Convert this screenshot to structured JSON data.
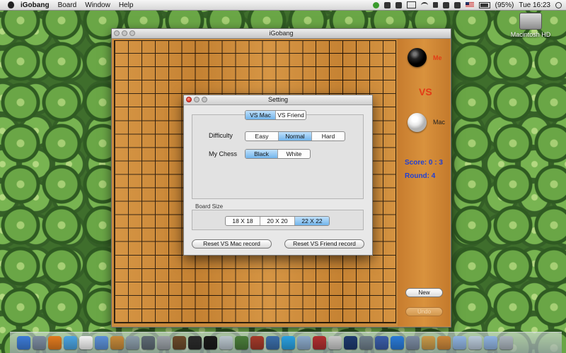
{
  "menubar": {
    "app_name": "iGobang",
    "items": [
      "Board",
      "Window",
      "Help"
    ],
    "battery": "(95%)",
    "clock": "Tue 16:23",
    "icons": [
      "apple-icon",
      "green-status-icon",
      "evernote-icon",
      "sync-icon",
      "display-icon",
      "wifi-icon",
      "lock-icon",
      "bluetooth-icon",
      "volume-icon",
      "flag-icon",
      "battery-icon",
      "search-icon"
    ]
  },
  "desktop": {
    "hd_label": "Macintosh HD"
  },
  "window": {
    "title": "iGobang",
    "board_lines": 22
  },
  "side": {
    "me_label": "Me",
    "vs_label": "VS",
    "mac_label": "Mac",
    "score": "Score:   0 : 3",
    "round": "Round:  4",
    "new_button": "New",
    "undo_button": "Undo"
  },
  "setting": {
    "title": "Setting",
    "tabs": [
      "VS Mac",
      "VS Friend"
    ],
    "active_tab": "VS Mac",
    "difficulty_label": "Difficulty",
    "difficulty_options": [
      "Easy",
      "Normal",
      "Hard"
    ],
    "difficulty_selected": "Normal",
    "chess_label": "My Chess",
    "chess_options": [
      "Black",
      "White"
    ],
    "chess_selected": "Black",
    "board_size_label": "Board Size",
    "board_size_options": [
      "18 X 18",
      "20 X 20",
      "22 X 22"
    ],
    "board_size_selected": "22 X 22",
    "reset_mac_button": "Reset VS Mac record",
    "reset_friend_button": "Reset VS Friend record"
  },
  "colors": {
    "accent_red": "#e33b16",
    "score_blue": "#1f3fd6",
    "board_wood": "#cf8b38",
    "selected_segment": "#72b5ec"
  },
  "dock": {
    "icons": [
      {
        "name": "finder-icon",
        "color": "#3c7bd6"
      },
      {
        "name": "system-icon",
        "color": "#7c8ca0"
      },
      {
        "name": "firefox-icon",
        "color": "#e07a1f"
      },
      {
        "name": "safari-icon",
        "color": "#4aa3e0"
      },
      {
        "name": "ical-icon",
        "color": "#f2f2f2"
      },
      {
        "name": "itunes-icon",
        "color": "#5b8fd6"
      },
      {
        "name": "photo-icon",
        "color": "#c58a3a"
      },
      {
        "name": "iphoto-icon",
        "color": "#8a9ba8"
      },
      {
        "name": "dashboard-icon",
        "color": "#5e6a74"
      },
      {
        "name": "preferences-icon",
        "color": "#9aa0a6"
      },
      {
        "name": "garageband-icon",
        "color": "#6b4a2a"
      },
      {
        "name": "activity-icon",
        "color": "#2a2a2a"
      },
      {
        "name": "terminal-icon",
        "color": "#1a1a1a"
      },
      {
        "name": "preview-icon",
        "color": "#b8c4cc"
      },
      {
        "name": "bird-icon",
        "color": "#4a7d3a"
      },
      {
        "name": "games-icon",
        "color": "#a33a2a"
      },
      {
        "name": "network-icon",
        "color": "#3a6da8"
      },
      {
        "name": "skype-icon",
        "color": "#2aa0e0"
      },
      {
        "name": "mail-icon",
        "color": "#8aa8c8"
      },
      {
        "name": "dictionary-icon",
        "color": "#b03030"
      },
      {
        "name": "stack-icon",
        "color": "#c8c8c8"
      },
      {
        "name": "photoshop-icon",
        "color": "#1e3a6e"
      },
      {
        "name": "utility-icon",
        "color": "#6e7e8a"
      },
      {
        "name": "book-icon",
        "color": "#3a5da8"
      },
      {
        "name": "app-store-icon",
        "color": "#2a7ad6"
      },
      {
        "name": "viewer-icon",
        "color": "#7a8aa0"
      },
      {
        "name": "tool-icon",
        "color": "#c89a4a"
      },
      {
        "name": "igobang-icon",
        "color": "#c9863a"
      },
      {
        "name": "folder-icon",
        "color": "#8fb3e0"
      },
      {
        "name": "documents-icon",
        "color": "#b8c8d8"
      },
      {
        "name": "downloads-icon",
        "color": "#8fb3e0"
      },
      {
        "name": "trash-icon",
        "color": "#aab4bc"
      }
    ]
  }
}
